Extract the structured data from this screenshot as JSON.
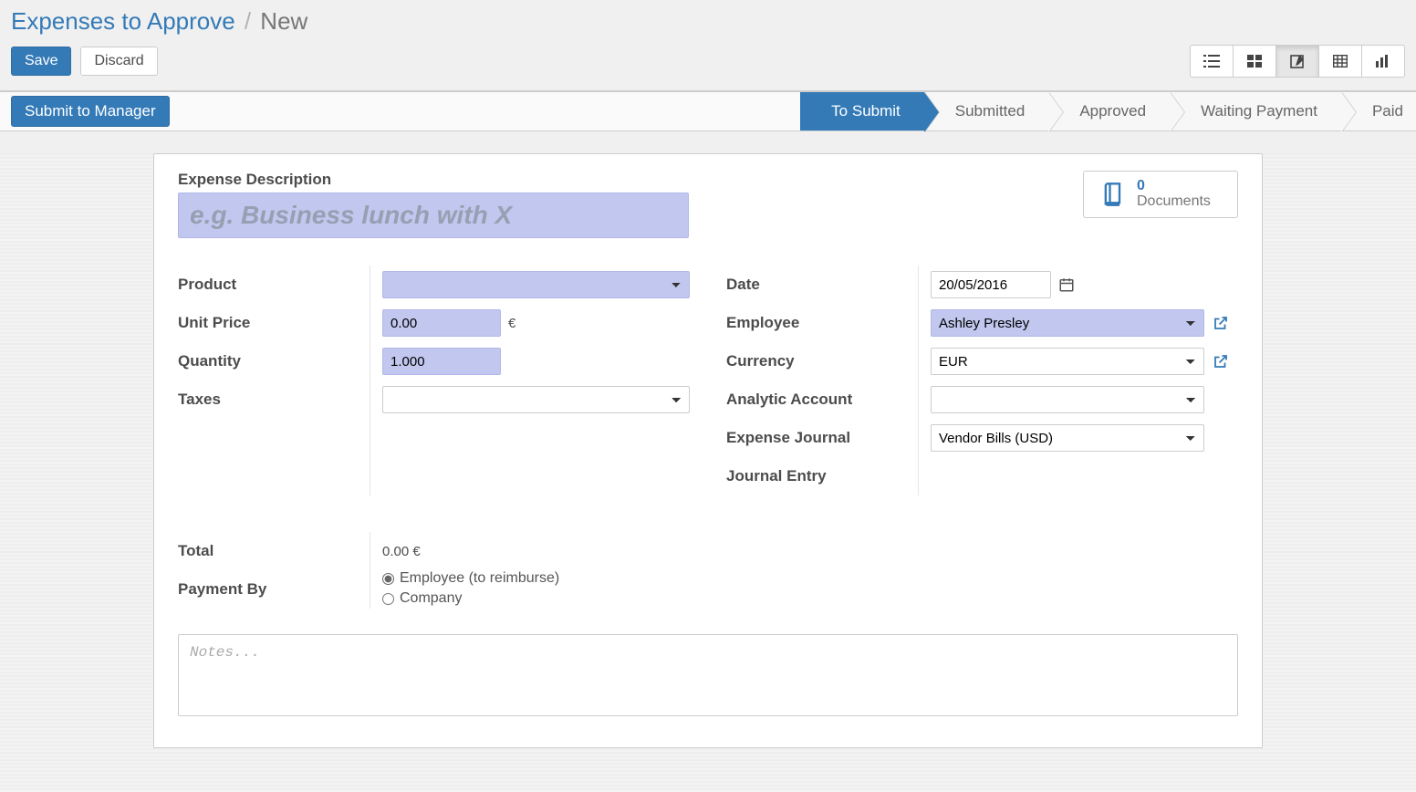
{
  "breadcrumb": {
    "parent": "Expenses to Approve",
    "current": "New"
  },
  "control_panel": {
    "save": "Save",
    "discard": "Discard"
  },
  "statusbar": {
    "submit_button": "Submit to Manager",
    "stages": {
      "to_submit": "To Submit",
      "submitted": "Submitted",
      "approved": "Approved",
      "waiting_payment": "Waiting Payment",
      "paid": "Paid"
    }
  },
  "sheet": {
    "title_label": "Expense Description",
    "title_placeholder": "e.g. Business lunch with X",
    "documents": {
      "count": "0",
      "label": "Documents"
    },
    "left": {
      "product_label": "Product",
      "product_value": "",
      "unit_price_label": "Unit Price",
      "unit_price_value": "0.00",
      "unit_price_symbol": "€",
      "quantity_label": "Quantity",
      "quantity_value": "1.000",
      "taxes_label": "Taxes",
      "taxes_value": ""
    },
    "right": {
      "date_label": "Date",
      "date_value": "20/05/2016",
      "employee_label": "Employee",
      "employee_value": "Ashley Presley",
      "currency_label": "Currency",
      "currency_value": "EUR",
      "analytic_label": "Analytic Account",
      "analytic_value": "",
      "journal_label": "Expense Journal",
      "journal_value": "Vendor Bills (USD)",
      "entry_label": "Journal Entry",
      "entry_value": ""
    },
    "bottom": {
      "total_label": "Total",
      "total_value": "0.00 €",
      "payment_label": "Payment By",
      "payment_opt1": "Employee (to reimburse)",
      "payment_opt2": "Company"
    },
    "notes_placeholder": "Notes..."
  }
}
